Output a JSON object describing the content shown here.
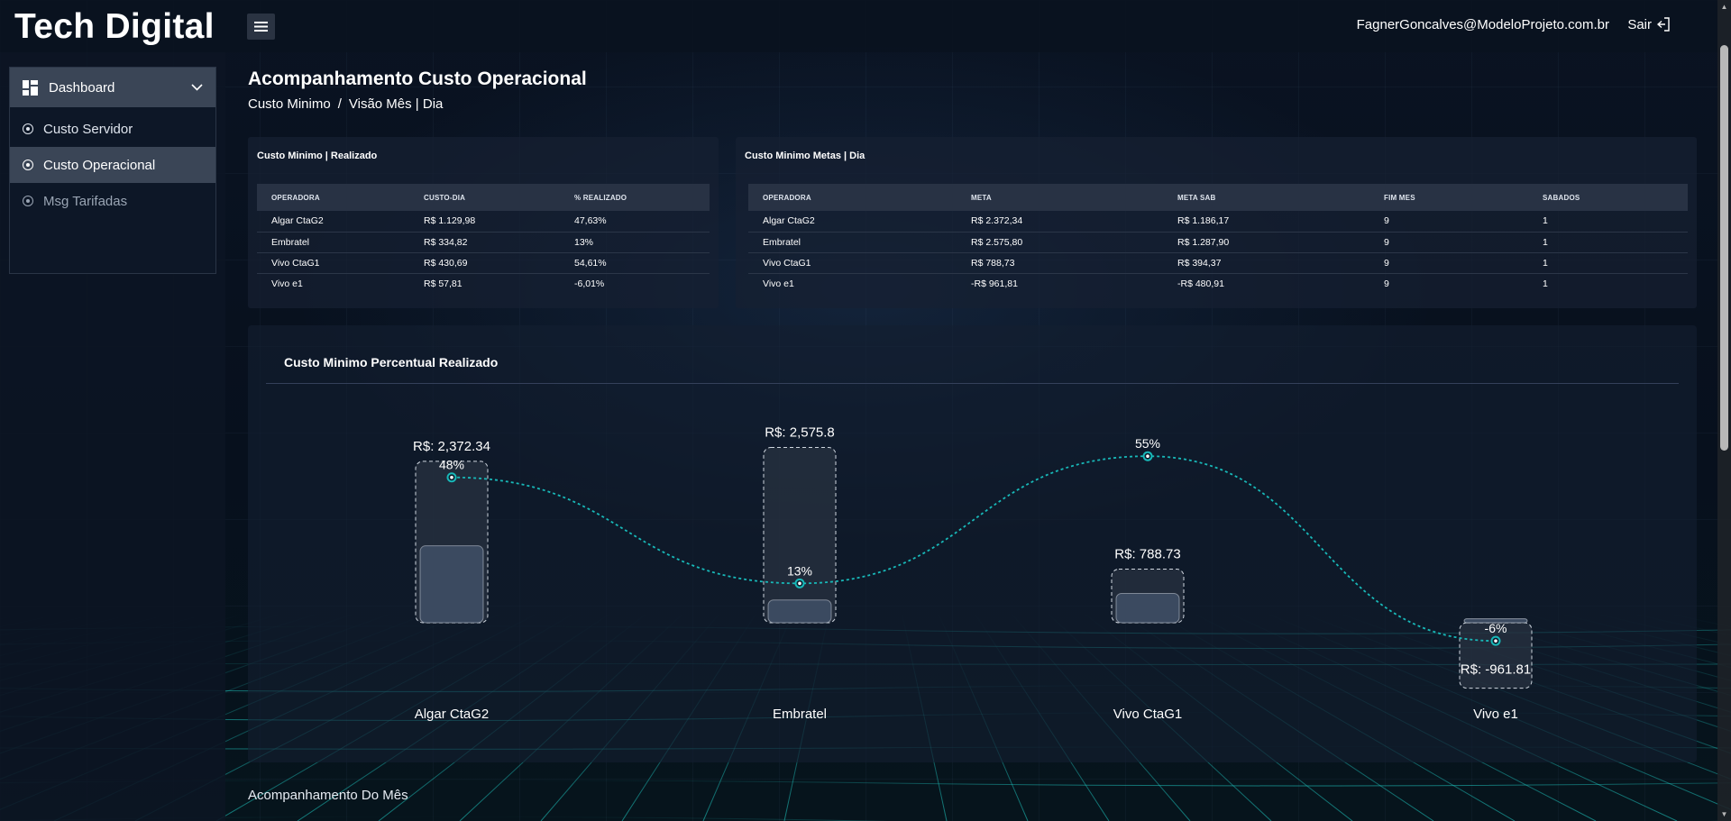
{
  "brand": "Tech Digital",
  "topbar": {
    "user_email": "FagnerGoncalves@ModeloProjeto.com.br",
    "logout_label": "Sair"
  },
  "sidebar": {
    "header": "Dashboard",
    "items": [
      {
        "label": "Custo Servidor",
        "active": false
      },
      {
        "label": "Custo Operacional",
        "active": true
      },
      {
        "label": "Msg Tarifadas",
        "active": false
      }
    ]
  },
  "page": {
    "title": "Acompanhamento Custo Operacional",
    "breadcrumb": [
      "Custo Minimo",
      "/",
      "Visão Mês | Dia"
    ],
    "footer_title": "Acompanhamento Do Mês"
  },
  "table_realizado": {
    "title": "Custo Minimo | Realizado",
    "columns": [
      "OPERADORA",
      "CUSTO-DIA",
      "% REALIZADO"
    ],
    "rows": [
      [
        "Algar CtaG2",
        "R$ 1.129,98",
        "47,63%"
      ],
      [
        "Embratel",
        "R$ 334,82",
        "13%"
      ],
      [
        "Vivo CtaG1",
        "R$ 430,69",
        "54,61%"
      ],
      [
        "Vivo e1",
        "R$ 57,81",
        "-6,01%"
      ]
    ]
  },
  "table_metas": {
    "title": "Custo Minimo Metas | Dia",
    "columns": [
      "OPERADORA",
      "META",
      "META SAB",
      "FIM MES",
      "SABADOS"
    ],
    "rows": [
      [
        "Algar CtaG2",
        "R$ 2.372,34",
        "R$ 1.186,17",
        "9",
        "1"
      ],
      [
        "Embratel",
        "R$ 2.575,80",
        "R$ 1.287,90",
        "9",
        "1"
      ],
      [
        "Vivo CtaG1",
        "R$ 788,73",
        "R$ 394,37",
        "9",
        "1"
      ],
      [
        "Vivo e1",
        "-R$ 961,81",
        "-R$ 480,91",
        "9",
        "1"
      ]
    ]
  },
  "chart_data": {
    "type": "bar",
    "title": "Custo Minimo Percentual Realizado",
    "categories": [
      "Algar CtaG2",
      "Embratel",
      "Vivo CtaG1",
      "Vivo e1"
    ],
    "meta_labels": [
      "R$: 2,372.34",
      "R$: 2,575.8",
      "R$: 788.73",
      "R$: -961.81"
    ],
    "percent_labels": [
      "48%",
      "13%",
      "55%",
      "-6%"
    ],
    "series": [
      {
        "values": [
          2372.34,
          2575.8,
          788.73,
          -961.81
        ]
      },
      {
        "values": [
          1129.98,
          334.82,
          430.69,
          57.81
        ]
      },
      {
        "values": [
          48,
          13,
          55,
          -6
        ]
      }
    ],
    "colors": {
      "line": "#18b8b8",
      "bar_fill": "#3b4a60",
      "target_fill": "#2a3342",
      "dashed": "#cfd6df"
    }
  }
}
